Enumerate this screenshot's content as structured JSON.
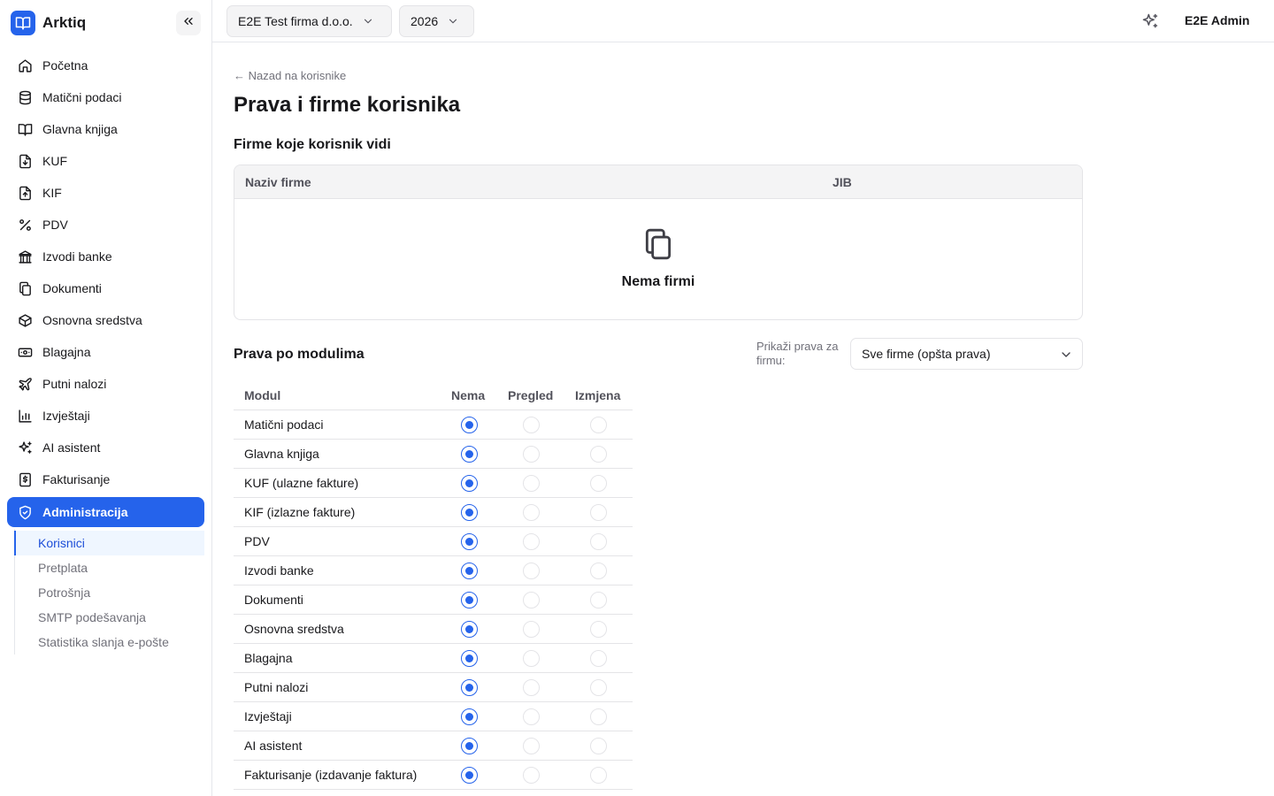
{
  "app": {
    "name": "Arktiq"
  },
  "colors": {
    "accent": "#2563eb",
    "muted": "#71717a",
    "border": "#e4e4e7"
  },
  "sidebar": {
    "items": [
      {
        "label": "Početna",
        "icon": "home-icon"
      },
      {
        "label": "Matični podaci",
        "icon": "database-icon"
      },
      {
        "label": "Glavna knjiga",
        "icon": "book-icon"
      },
      {
        "label": "KUF",
        "icon": "file-download-icon"
      },
      {
        "label": "KIF",
        "icon": "file-upload-icon"
      },
      {
        "label": "PDV",
        "icon": "percent-icon"
      },
      {
        "label": "Izvodi banke",
        "icon": "bank-icon"
      },
      {
        "label": "Dokumenti",
        "icon": "documents-icon"
      },
      {
        "label": "Osnovna sredstva",
        "icon": "box-icon"
      },
      {
        "label": "Blagajna",
        "icon": "cash-icon"
      },
      {
        "label": "Putni nalozi",
        "icon": "plane-icon"
      },
      {
        "label": "Izvještaji",
        "icon": "bar-chart-icon"
      },
      {
        "label": "AI asistent",
        "icon": "sparkles-icon"
      },
      {
        "label": "Fakturisanje",
        "icon": "invoice-dollar-icon"
      },
      {
        "label": "Administracija",
        "icon": "shield-icon",
        "active": true
      }
    ],
    "subitems": [
      {
        "label": "Korisnici",
        "active": true
      },
      {
        "label": "Pretplata"
      },
      {
        "label": "Potrošnja"
      },
      {
        "label": "SMTP podešavanja"
      },
      {
        "label": "Statistika slanja e-pošte"
      }
    ]
  },
  "topbar": {
    "company": "E2E Test firma d.o.o.",
    "year": "2026",
    "user": "E2E Admin"
  },
  "page": {
    "back": "← Nazad na korisnike",
    "title": "Prava i firme korisnika",
    "firms_section": "Firme koje korisnik vidi",
    "firms_columns": [
      "Naziv firme",
      "JIB"
    ],
    "firms_empty": "Nema firmi",
    "perm_section": "Prava po modulima",
    "filter_label": "Prikaži prava za firmu:",
    "filter_value": "Sve firme (opšta prava)",
    "perm_columns": [
      "Modul",
      "Nema",
      "Pregled",
      "Izmjena"
    ],
    "modules": [
      {
        "name": "Matični podaci",
        "level": "Nema"
      },
      {
        "name": "Glavna knjiga",
        "level": "Nema"
      },
      {
        "name": "KUF (ulazne fakture)",
        "level": "Nema"
      },
      {
        "name": "KIF (izlazne fakture)",
        "level": "Nema"
      },
      {
        "name": "PDV",
        "level": "Nema"
      },
      {
        "name": "Izvodi banke",
        "level": "Nema"
      },
      {
        "name": "Dokumenti",
        "level": "Nema"
      },
      {
        "name": "Osnovna sredstva",
        "level": "Nema"
      },
      {
        "name": "Blagajna",
        "level": "Nema"
      },
      {
        "name": "Putni nalozi",
        "level": "Nema"
      },
      {
        "name": "Izvještaji",
        "level": "Nema"
      },
      {
        "name": "AI asistent",
        "level": "Nema"
      },
      {
        "name": "Fakturisanje (izdavanje faktura)",
        "level": "Nema"
      }
    ]
  }
}
